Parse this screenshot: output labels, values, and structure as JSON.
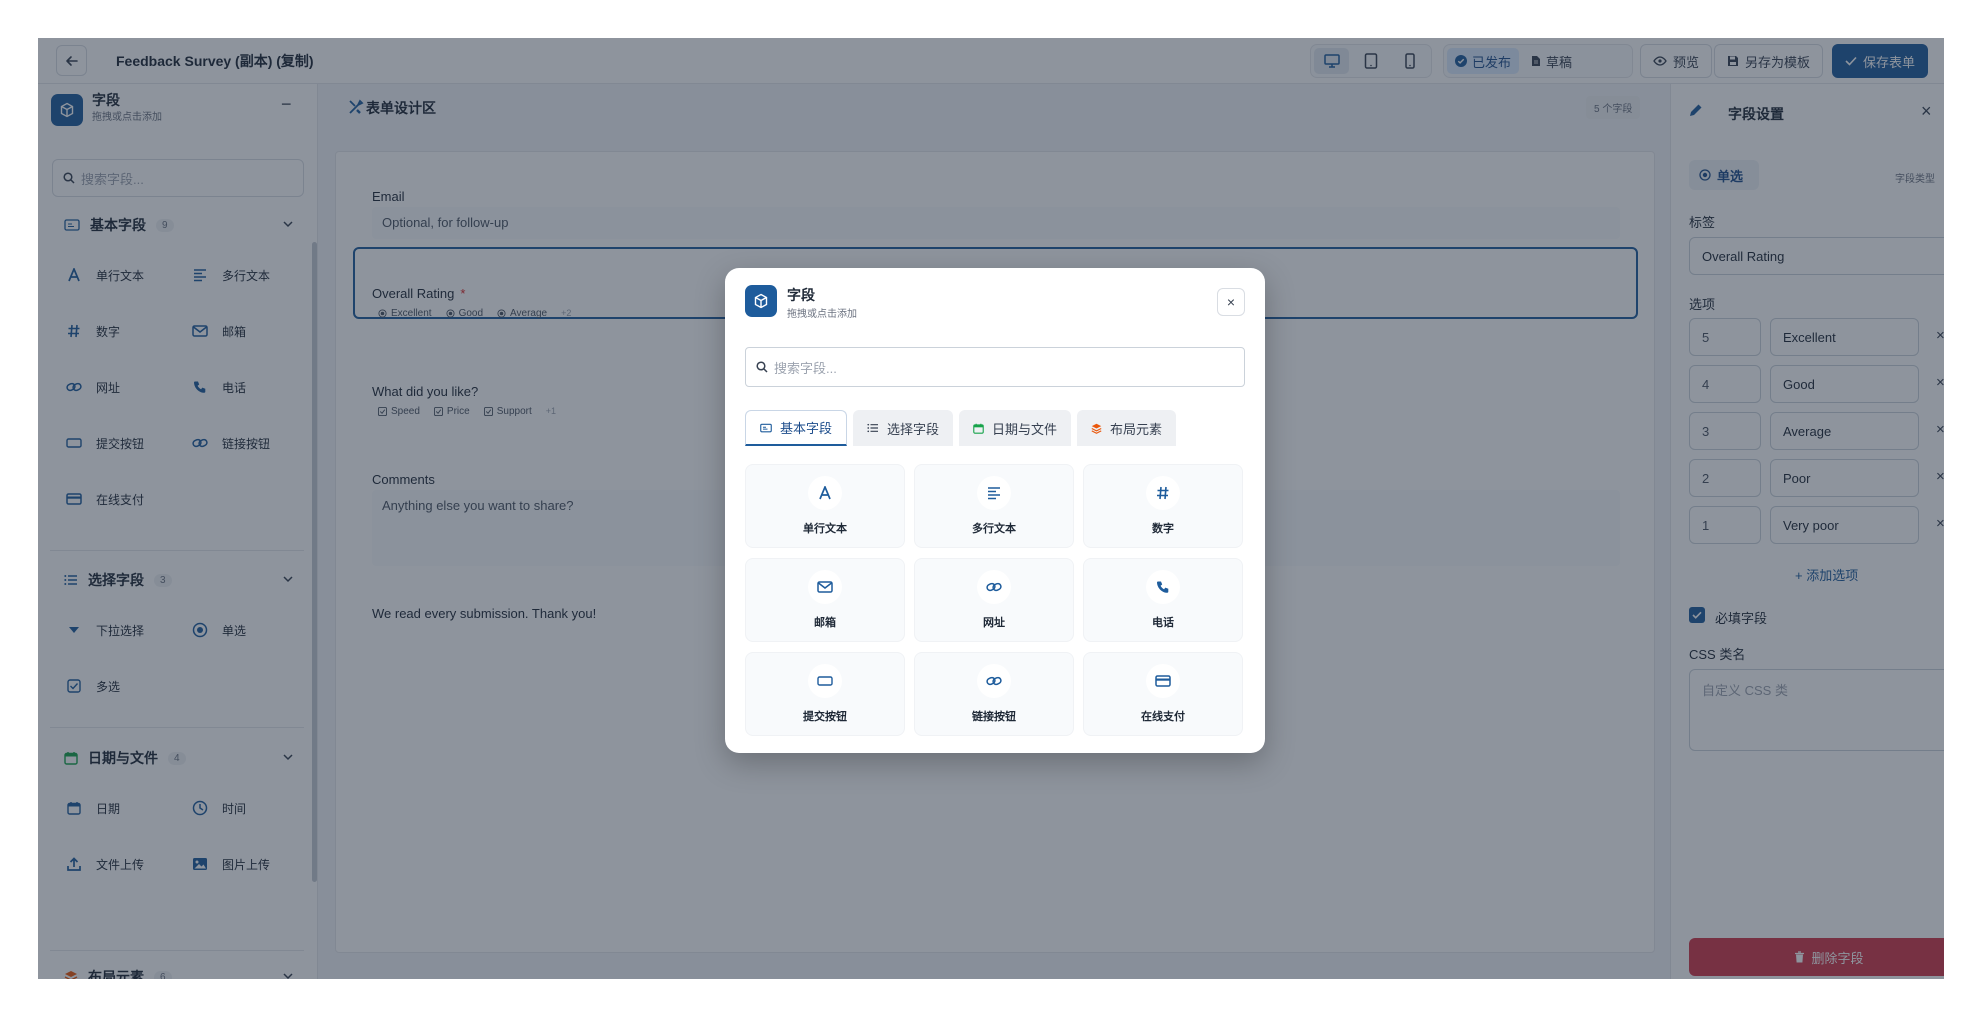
{
  "header": {
    "title": "Feedback Survey (副本) (复制)",
    "status_published": "已发布",
    "status_draft": "草稿",
    "preview": "预览",
    "save_template": "另存为模板",
    "save_form": "保存表单"
  },
  "sidebar": {
    "title": "字段",
    "subtitle": "拖拽或点击添加",
    "search_placeholder": "搜索字段...",
    "sections": [
      {
        "title": "基本字段",
        "count": "9",
        "icon": "id-card-icon",
        "items": [
          {
            "label": "单行文本",
            "icon": "font-a-icon"
          },
          {
            "label": "多行文本",
            "icon": "align-left-icon"
          },
          {
            "label": "数字",
            "icon": "hashtag-icon"
          },
          {
            "label": "邮箱",
            "icon": "envelope-icon"
          },
          {
            "label": "网址",
            "icon": "link-icon"
          },
          {
            "label": "电话",
            "icon": "phone-icon"
          },
          {
            "label": "提交按钮",
            "icon": "button-icon"
          },
          {
            "label": "链接按钮",
            "icon": "link-icon"
          },
          {
            "label": "在线支付",
            "icon": "credit-card-icon"
          }
        ]
      },
      {
        "title": "选择字段",
        "count": "3",
        "icon": "list-icon",
        "items": [
          {
            "label": "下拉选择",
            "icon": "caret-down-icon"
          },
          {
            "label": "单选",
            "icon": "radio-icon"
          },
          {
            "label": "多选",
            "icon": "checkbox-icon"
          }
        ]
      },
      {
        "title": "日期与文件",
        "count": "4",
        "icon": "calendar-icon",
        "items": [
          {
            "label": "日期",
            "icon": "calendar-icon"
          },
          {
            "label": "时间",
            "icon": "clock-icon"
          },
          {
            "label": "文件上传",
            "icon": "upload-icon"
          },
          {
            "label": "图片上传",
            "icon": "image-icon"
          }
        ]
      },
      {
        "title": "布局元素",
        "count": "6",
        "icon": "layers-icon",
        "items": []
      }
    ]
  },
  "canvas": {
    "title": "表单设计区",
    "field_count": "5 个字段",
    "fields": {
      "email_label": "Email",
      "email_placeholder": "Optional, for follow-up",
      "rating_label": "Overall Rating",
      "rating_required_mark": "*",
      "rating_options": [
        "Excellent",
        "Good",
        "Average"
      ],
      "rating_more": "+2",
      "liked_label": "What did you like?",
      "liked_options": [
        "Speed",
        "Price",
        "Support"
      ],
      "liked_more": "+1",
      "comments_label": "Comments",
      "comments_placeholder": "Anything else you want to share?",
      "footer_text": "We read every submission. Thank you!"
    }
  },
  "settings": {
    "title": "字段设置",
    "field_type": "单选",
    "field_type_label": "字段类型",
    "label_heading": "标签",
    "label_value": "Overall Rating",
    "options_heading": "选项",
    "options": [
      {
        "value": "5",
        "label": "Excellent"
      },
      {
        "value": "4",
        "label": "Good"
      },
      {
        "value": "3",
        "label": "Average"
      },
      {
        "value": "2",
        "label": "Poor"
      },
      {
        "value": "1",
        "label": "Very poor"
      }
    ],
    "add_option": "+ 添加选项",
    "required_label": "必填字段",
    "required_checked": true,
    "css_heading": "CSS 类名",
    "css_placeholder": "自定义 CSS 类",
    "delete_label": "删除字段"
  },
  "modal": {
    "title": "字段",
    "subtitle": "拖拽或点击添加",
    "search_placeholder": "搜索字段...",
    "tabs": [
      "基本字段",
      "选择字段",
      "日期与文件",
      "布局元素"
    ],
    "active_tab": "基本字段",
    "items": [
      {
        "label": "单行文本",
        "icon": "font-a-icon"
      },
      {
        "label": "多行文本",
        "icon": "align-left-icon"
      },
      {
        "label": "数字",
        "icon": "hashtag-icon"
      },
      {
        "label": "邮箱",
        "icon": "envelope-icon"
      },
      {
        "label": "网址",
        "icon": "link-icon"
      },
      {
        "label": "电话",
        "icon": "phone-icon"
      },
      {
        "label": "提交按钮",
        "icon": "button-icon"
      },
      {
        "label": "链接按钮",
        "icon": "link-icon"
      },
      {
        "label": "在线支付",
        "icon": "credit-card-icon"
      }
    ]
  },
  "colors": {
    "brand": "#1e5c9c",
    "danger": "#d0394b",
    "overlay": "rgba(30,41,59,0.5)",
    "date_accent": "#16a34a",
    "layout_accent": "#ea580c"
  }
}
